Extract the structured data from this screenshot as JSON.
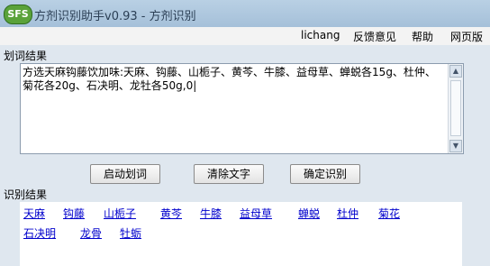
{
  "window": {
    "logo_text": "SFS",
    "title": "方剂识别助手v0.93 - 方剂识别"
  },
  "menu": [
    "lichang",
    "反馈意见",
    "帮助",
    "网页版"
  ],
  "input_section": {
    "label": "划词结果",
    "text": "方选天麻钩藤饮加味:天麻、钩藤、山栀子、黄芩、牛膝、益母草、蝉蜕各15g、杜仲、菊花各20g、石决明、龙牡各50g,0|"
  },
  "buttons": {
    "start": "启动划词",
    "clear": "清除文字",
    "confirm": "确定识别"
  },
  "results_section": {
    "label": "识别结果",
    "row1": [
      "天麻",
      "钩藤",
      "山栀子",
      "黄芩",
      "牛膝",
      "益母草",
      "蝉蜕",
      "杜仲",
      "菊花"
    ],
    "row2": [
      "石决明",
      "龙骨",
      "牡蛎"
    ]
  },
  "icons": {
    "scroll_up": "arrow-up-icon",
    "scroll_down": "arrow-down-icon"
  }
}
